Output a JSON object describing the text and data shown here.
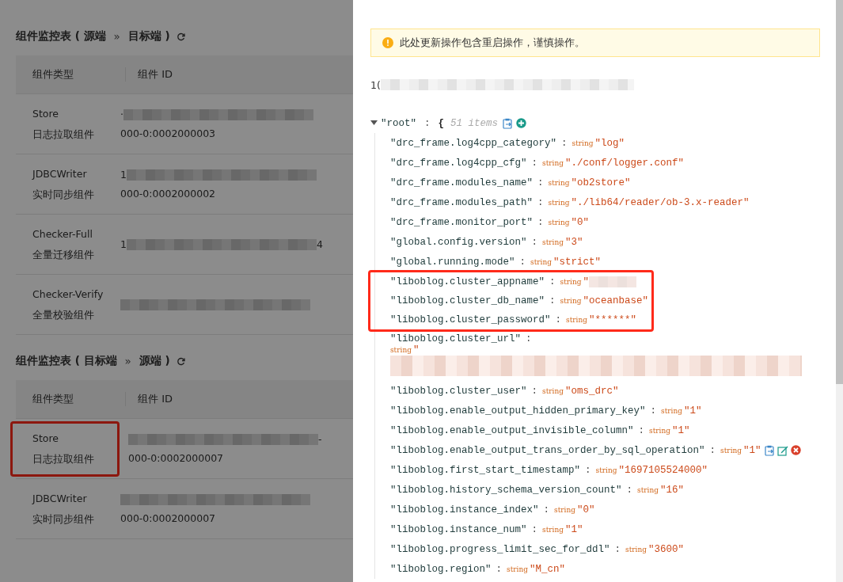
{
  "tables": [
    {
      "title_parts": [
        "组件监控表 ( 源端",
        "»",
        "目标端 )"
      ],
      "columns": [
        "组件类型",
        "组件 ID"
      ],
      "rows": [
        {
          "type": "Store",
          "type_desc": "日志拉取组件",
          "highlighted": false,
          "id_lines": [
            [
              {
                "kind": "text",
                "text": "·"
              },
              {
                "kind": "redacted"
              }
            ],
            [
              {
                "kind": "text",
                "text": "000-0:0002000003"
              }
            ]
          ]
        },
        {
          "type": "JDBCWriter",
          "type_desc": "实时同步组件",
          "highlighted": false,
          "id_lines": [
            [
              {
                "kind": "text",
                "text": "1"
              },
              {
                "kind": "redacted"
              }
            ],
            [
              {
                "kind": "text",
                "text": "000-0:0002000002"
              }
            ]
          ]
        },
        {
          "type": "Checker-Full",
          "type_desc": "全量迁移组件",
          "highlighted": false,
          "id_lines": [
            [
              {
                "kind": "text",
                "text": "1"
              },
              {
                "kind": "redacted"
              },
              {
                "kind": "text",
                "text": "4"
              }
            ]
          ]
        },
        {
          "type": "Checker-Verify",
          "type_desc": "全量校验组件",
          "highlighted": false,
          "id_lines": [
            [
              {
                "kind": "redacted"
              }
            ]
          ]
        }
      ]
    },
    {
      "title_parts": [
        "组件监控表 ( 目标端",
        "»",
        "源端 )"
      ],
      "columns": [
        "组件类型",
        "组件 ID"
      ],
      "rows": [
        {
          "type": "Store",
          "type_desc": "日志拉取组件",
          "highlighted": true,
          "id_lines": [
            [
              {
                "kind": "redacted"
              },
              {
                "kind": "text",
                "text": "-"
              }
            ],
            [
              {
                "kind": "text",
                "text": "000-0:0002000007"
              }
            ]
          ]
        },
        {
          "type": "JDBCWriter",
          "type_desc": "实时同步组件",
          "highlighted": false,
          "id_lines": [
            [
              {
                "kind": "redacted"
              }
            ],
            [
              {
                "kind": "text",
                "text": "000-0:0002000007"
              }
            ]
          ]
        }
      ]
    }
  ],
  "drawer": {
    "alert": "此处更新操作包含重启操作，谨慎操作。",
    "path_parts": [
      {
        "kind": "text",
        "text": "1("
      },
      {
        "kind": "redacted"
      }
    ],
    "tree": {
      "key": "\"root\"",
      "sep": ":",
      "brace": "{",
      "count": "51 items",
      "expanded": true,
      "items": [
        {
          "key": "\"drc_frame.log4cpp_category\"",
          "sep": ":",
          "type": "string",
          "value": [
            {
              "kind": "text",
              "text": "\"log\""
            }
          ],
          "highlighted": false,
          "hovered": false
        },
        {
          "key": "\"drc_frame.log4cpp_cfg\"",
          "sep": ":",
          "type": "string",
          "value": [
            {
              "kind": "text",
              "text": "\"./conf/logger.conf\""
            }
          ],
          "highlighted": false,
          "hovered": false
        },
        {
          "key": "\"drc_frame.modules_name\"",
          "sep": ":",
          "type": "string",
          "value": [
            {
              "kind": "text",
              "text": "\"ob2store\""
            }
          ],
          "highlighted": false,
          "hovered": false
        },
        {
          "key": "\"drc_frame.modules_path\"",
          "sep": ":",
          "type": "string",
          "value": [
            {
              "kind": "text",
              "text": "\"./lib64/reader/ob-3.x-reader\""
            }
          ],
          "highlighted": false,
          "hovered": false
        },
        {
          "key": "\"drc_frame.monitor_port\"",
          "sep": ":",
          "type": "string",
          "value": [
            {
              "kind": "text",
              "text": "\"0\""
            }
          ],
          "highlighted": false,
          "hovered": false
        },
        {
          "key": "\"global.config.version\"",
          "sep": ":",
          "type": "string",
          "value": [
            {
              "kind": "text",
              "text": "\"3\""
            }
          ],
          "highlighted": false,
          "hovered": false
        },
        {
          "key": "\"global.running.mode\"",
          "sep": ":",
          "type": "string",
          "value": [
            {
              "kind": "text",
              "text": "\"strict\""
            }
          ],
          "highlighted": false,
          "hovered": false
        },
        {
          "key": "\"liboblog.cluster_appname\"",
          "sep": ":",
          "type": "string",
          "value": [
            {
              "kind": "text",
              "text": "\""
            },
            {
              "kind": "redacted"
            }
          ],
          "highlighted": true,
          "hovered": false
        },
        {
          "key": "\"liboblog.cluster_db_name\"",
          "sep": ":",
          "type": "string",
          "value": [
            {
              "kind": "text",
              "text": "\"oceanbase\""
            }
          ],
          "highlighted": true,
          "hovered": false
        },
        {
          "key": "\"liboblog.cluster_password\"",
          "sep": ":",
          "type": "string",
          "value": [
            {
              "kind": "text",
              "text": "\"******\""
            }
          ],
          "highlighted": true,
          "hovered": false
        },
        {
          "key": "\"liboblog.cluster_url\"",
          "sep": ":",
          "type": "string",
          "value": [
            {
              "kind": "text",
              "text": "\""
            },
            {
              "kind": "redacted_long"
            }
          ],
          "highlighted": false,
          "hovered": false
        },
        {
          "key": "\"liboblog.cluster_user\"",
          "sep": ":",
          "type": "string",
          "value": [
            {
              "kind": "text",
              "text": "\"oms_drc\""
            }
          ],
          "highlighted": false,
          "hovered": false
        },
        {
          "key": "\"liboblog.enable_output_hidden_primary_key\"",
          "sep": ":",
          "type": "string",
          "value": [
            {
              "kind": "text",
              "text": "\"1\""
            }
          ],
          "highlighted": false,
          "hovered": false
        },
        {
          "key": "\"liboblog.enable_output_invisible_column\"",
          "sep": ":",
          "type": "string",
          "value": [
            {
              "kind": "text",
              "text": "\"1\""
            }
          ],
          "highlighted": false,
          "hovered": false
        },
        {
          "key": "\"liboblog.enable_output_trans_order_by_sql_operation\"",
          "sep": ":",
          "type": "string",
          "value": [
            {
              "kind": "text",
              "text": "\"1\""
            }
          ],
          "highlighted": false,
          "hovered": true
        },
        {
          "key": "\"liboblog.first_start_timestamp\"",
          "sep": ":",
          "type": "string",
          "value": [
            {
              "kind": "text",
              "text": "\"1697105524000\""
            }
          ],
          "highlighted": false,
          "hovered": false
        },
        {
          "key": "\"liboblog.history_schema_version_count\"",
          "sep": ":",
          "type": "string",
          "value": [
            {
              "kind": "text",
              "text": "\"16\""
            }
          ],
          "highlighted": false,
          "hovered": false
        },
        {
          "key": "\"liboblog.instance_index\"",
          "sep": ":",
          "type": "string",
          "value": [
            {
              "kind": "text",
              "text": "\"0\""
            }
          ],
          "highlighted": false,
          "hovered": false
        },
        {
          "key": "\"liboblog.instance_num\"",
          "sep": ":",
          "type": "string",
          "value": [
            {
              "kind": "text",
              "text": "\"1\""
            }
          ],
          "highlighted": false,
          "hovered": false
        },
        {
          "key": "\"liboblog.progress_limit_sec_for_ddl\"",
          "sep": ":",
          "type": "string",
          "value": [
            {
              "kind": "text",
              "text": "\"3600\""
            }
          ],
          "highlighted": false,
          "hovered": false
        },
        {
          "key": "\"liboblog.region\"",
          "sep": ":",
          "type": "string",
          "value": [
            {
              "kind": "text",
              "text": "\"M_cn\""
            }
          ],
          "highlighted": false,
          "hovered": false
        }
      ]
    }
  }
}
